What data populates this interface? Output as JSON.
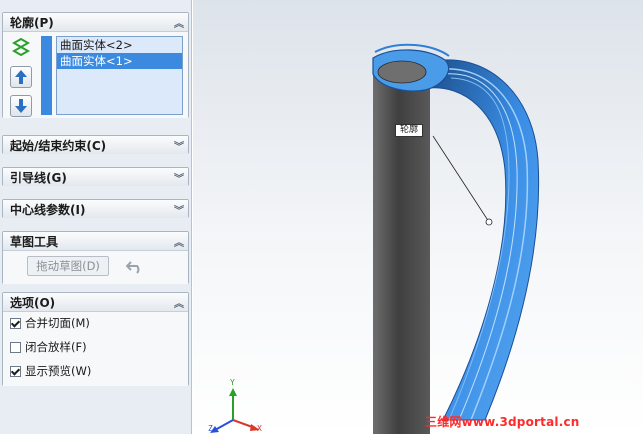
{
  "panel": {
    "profile": {
      "title": "轮廓(P)",
      "items": [
        "曲面实体<2>",
        "曲面实体<1>"
      ],
      "selected_index": 1
    },
    "start_end": {
      "title": "起始/结束约束(C)"
    },
    "guide": {
      "title": "引导线(G)"
    },
    "centerline": {
      "title": "中心线参数(I)"
    },
    "sketch_tools": {
      "title": "草图工具",
      "drag_sketch_label": "拖动草图(D)"
    },
    "options": {
      "title": "选项(O)",
      "items": [
        {
          "label": "合并切面(M)",
          "checked": true
        },
        {
          "label": "闭合放样(F)",
          "checked": false
        },
        {
          "label": "显示预览(W)",
          "checked": true
        }
      ]
    }
  },
  "viewport": {
    "callout_label": "轮廓",
    "watermark": "三维网www.3dportal.cn",
    "triad": {
      "x": "X",
      "y": "Y",
      "z": "Z"
    }
  },
  "icons": [
    "chevron-up-icon",
    "chevron-down-icon",
    "loft-profile-icon",
    "arrow-up-icon",
    "arrow-down-icon",
    "undo-icon"
  ],
  "colors": {
    "accent_blue": "#3b8ae0",
    "surface_blue": "#3a8ee6",
    "cylinder_gray": "#5b5b5b",
    "watermark_red": "#ff2b2b"
  }
}
